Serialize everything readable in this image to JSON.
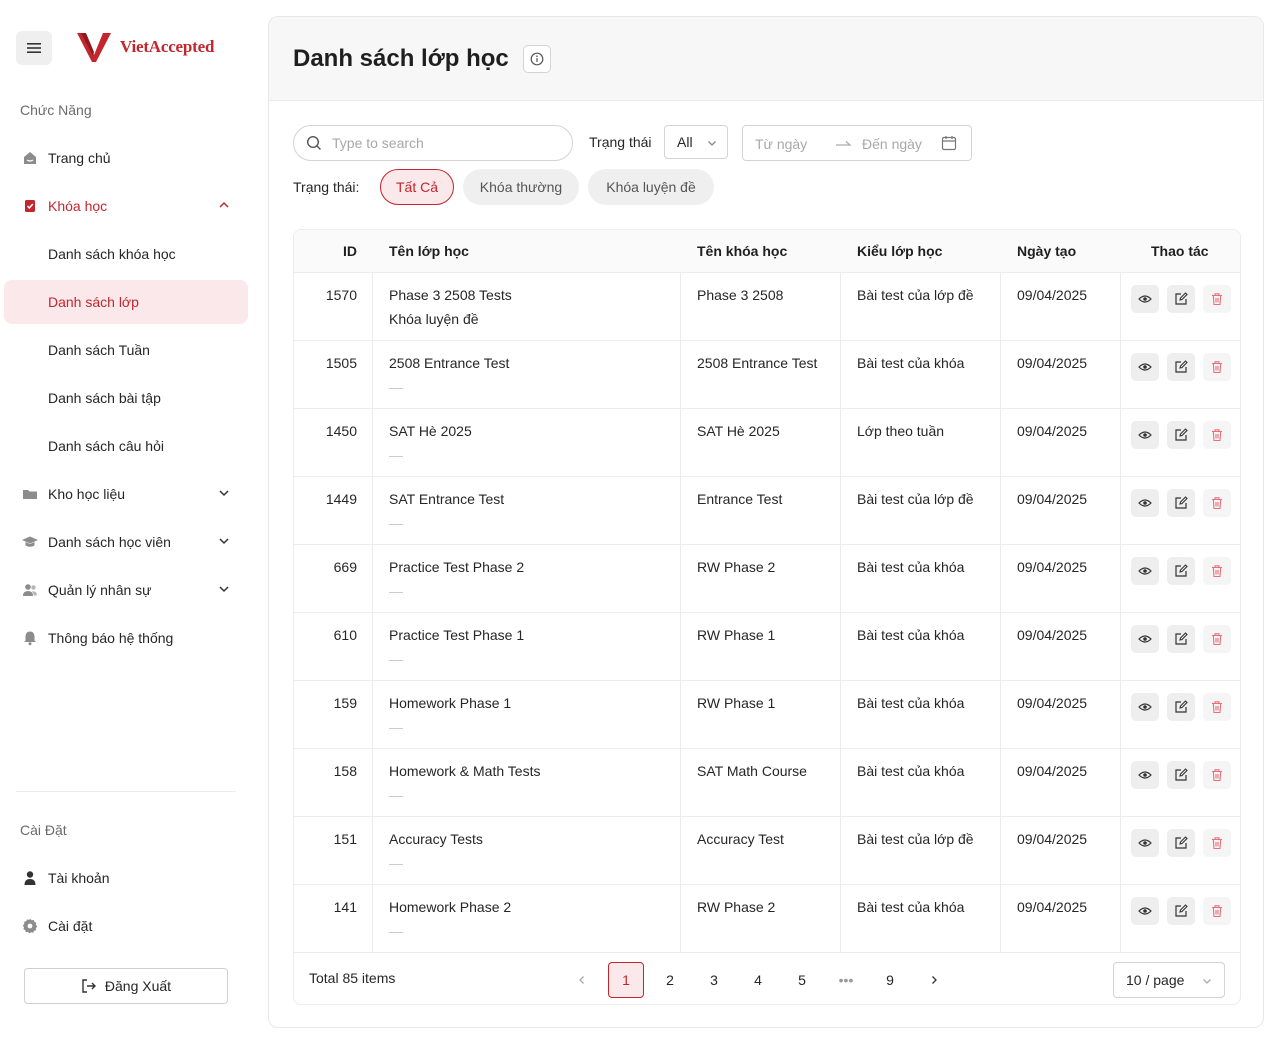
{
  "brand": {
    "name": "VietAccepted",
    "color": "#c4262e"
  },
  "sidebar": {
    "section_features": "Chức Năng",
    "items": [
      {
        "label": "Trang chủ",
        "icon": "home-icon"
      },
      {
        "label": "Khóa học",
        "icon": "course-icon"
      },
      {
        "label": "Danh sách khóa học"
      },
      {
        "label": "Danh sách lớp"
      },
      {
        "label": "Danh sách Tuần"
      },
      {
        "label": "Danh sách bài tập"
      },
      {
        "label": "Danh sách câu hỏi"
      },
      {
        "label": "Kho học liệu",
        "icon": "folder-icon"
      },
      {
        "label": "Danh sách học viên",
        "icon": "graduation-cap-icon"
      },
      {
        "label": "Quản lý nhân sự",
        "icon": "users-icon"
      },
      {
        "label": "Thông báo hệ thống",
        "icon": "bell-icon"
      }
    ],
    "section_settings": "Cài Đặt",
    "settings_items": [
      {
        "label": "Tài khoản",
        "icon": "user-icon"
      },
      {
        "label": "Cài đặt",
        "icon": "gear-icon"
      }
    ],
    "logout_label": "Đăng Xuất"
  },
  "main": {
    "title": "Danh sách lớp học",
    "search_placeholder": "Type to search",
    "status_label": "Trạng thái",
    "status_value": "All",
    "date_from": "Từ ngày",
    "date_to": "Đến ngày",
    "chips_label": "Trạng thái:",
    "chips": [
      "Tất Cả",
      "Khóa thường",
      "Khóa luyện đề"
    ],
    "active_chip": "Tất Cả"
  },
  "table": {
    "columns": [
      "ID",
      "Tên lớp học",
      "Tên khóa học",
      "Kiểu lớp học",
      "Ngày tạo",
      "Thao tác"
    ],
    "rows": [
      {
        "id": "1570",
        "name": "Phase 3 2508 Tests",
        "sub": "Khóa luyện đề",
        "course": "Phase 3 2508",
        "type": "Bài test của lớp đề",
        "date": "09/04/2025"
      },
      {
        "id": "1505",
        "name": "2508 Entrance Test",
        "sub": "—",
        "course": "2508 Entrance Test",
        "type": "Bài test của khóa",
        "date": "09/04/2025"
      },
      {
        "id": "1450",
        "name": "SAT Hè 2025",
        "sub": "—",
        "course": "SAT Hè 2025",
        "type": "Lớp theo tuần",
        "date": "09/04/2025"
      },
      {
        "id": "1449",
        "name": "SAT Entrance Test",
        "sub": "—",
        "course": "Entrance Test",
        "type": "Bài test của lớp đề",
        "date": "09/04/2025"
      },
      {
        "id": "669",
        "name": "Practice Test Phase 2",
        "sub": "—",
        "course": "RW Phase 2",
        "type": "Bài test của khóa",
        "date": "09/04/2025"
      },
      {
        "id": "610",
        "name": "Practice Test Phase 1",
        "sub": "—",
        "course": "RW Phase 1",
        "type": "Bài test của khóa",
        "date": "09/04/2025"
      },
      {
        "id": "159",
        "name": "Homework Phase 1",
        "sub": "—",
        "course": "RW Phase 1",
        "type": "Bài test của khóa",
        "date": "09/04/2025"
      },
      {
        "id": "158",
        "name": "Homework & Math Tests",
        "sub": "—",
        "course": "SAT Math Course",
        "type": "Bài test của khóa",
        "date": "09/04/2025"
      },
      {
        "id": "151",
        "name": "Accuracy Tests",
        "sub": "—",
        "course": "Accuracy Test",
        "type": "Bài test của lớp đề",
        "date": "09/04/2025"
      },
      {
        "id": "141",
        "name": "Homework Phase 2",
        "sub": "—",
        "course": "RW Phase 2",
        "type": "Bài test của khóa",
        "date": "09/04/2025"
      }
    ]
  },
  "pagination": {
    "total": "Total 85 items",
    "pages": [
      "1",
      "2",
      "3",
      "4",
      "5",
      "•••",
      "9"
    ],
    "current": "1",
    "page_size": "10 / page"
  }
}
